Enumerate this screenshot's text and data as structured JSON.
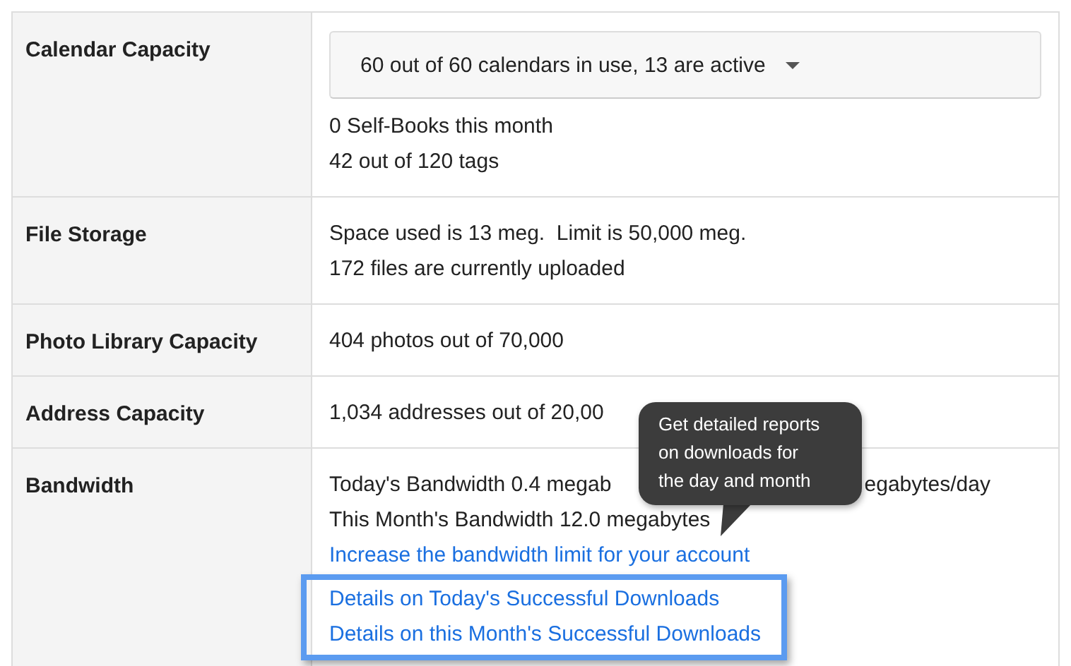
{
  "rows": [
    {
      "label": "Calendar Capacity",
      "kind": "dropdown",
      "dropdown": {
        "value": "60 out of 60 calendars in use, 13 are active"
      },
      "lines": [
        {
          "kind": "text",
          "text": "0 Self-Books this month"
        },
        {
          "kind": "text",
          "text": "42 out of 120 tags"
        }
      ]
    },
    {
      "label": "File Storage",
      "kind": "plain",
      "lines": [
        {
          "kind": "text",
          "text": "Space used is 13 meg.  Limit is 50,000 meg."
        },
        {
          "kind": "text",
          "text": "172 files are currently uploaded"
        }
      ]
    },
    {
      "label": "Photo Library Capacity",
      "kind": "plain",
      "lines": [
        {
          "kind": "text",
          "text": "404 photos out of 70,000"
        }
      ]
    },
    {
      "label": "Address Capacity",
      "kind": "plain",
      "lines": [
        {
          "kind": "text",
          "text": "1,034 addresses out of 20,00"
        }
      ]
    },
    {
      "label": "Bandwidth",
      "kind": "plain",
      "lines": [
        {
          "kind": "split",
          "parts": [
            "Today's Bandwidth 0.4 megab",
            "egabytes/day"
          ]
        },
        {
          "kind": "text",
          "text": "This Month's Bandwidth 12.0 megabytes"
        },
        {
          "kind": "link",
          "text": "Increase the bandwidth limit for your account"
        }
      ],
      "highlighted_links": [
        "Details on Today's Successful Downloads",
        "Details on this Month's Successful Downloads"
      ]
    }
  ],
  "tooltip": {
    "lines": [
      "Get detailed reports",
      "on downloads for",
      "the day and month"
    ]
  }
}
